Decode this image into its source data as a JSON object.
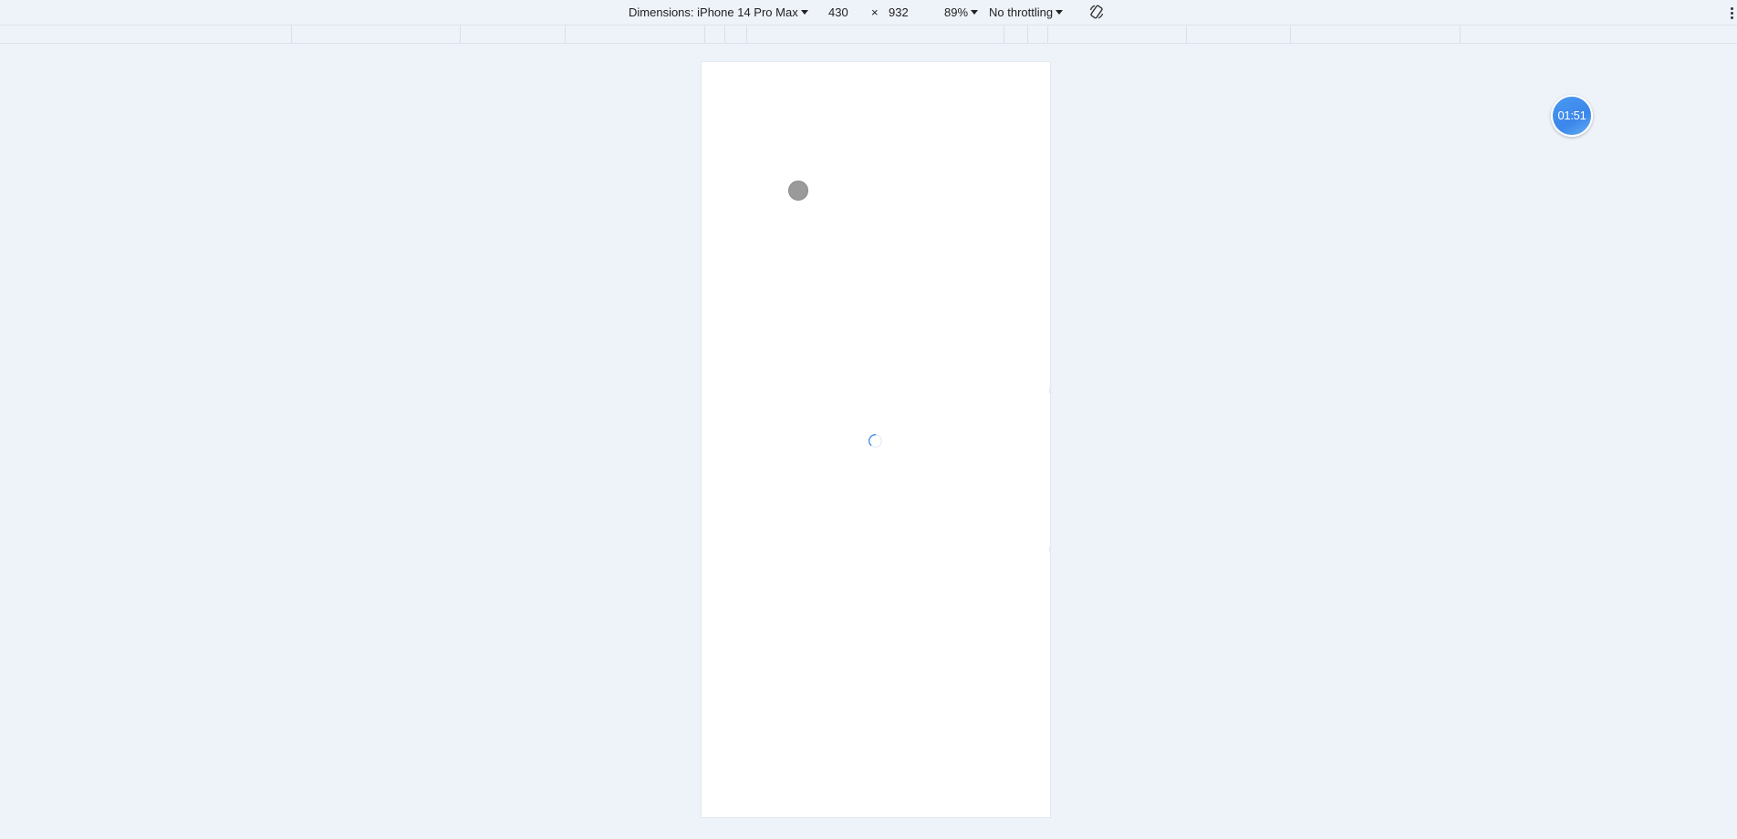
{
  "toolbar": {
    "dimensions_label": "Dimensions: iPhone 14 Pro Max",
    "width_value": "430",
    "times_symbol": "×",
    "height_value": "932",
    "zoom_label": "89%",
    "throttling_label": "No throttling"
  },
  "device": {
    "loading": true
  },
  "timer": {
    "time": "01:51"
  },
  "colors": {
    "background": "#eef2f9",
    "device_bg": "#ffffff",
    "timer_bg": "#3b86ea",
    "spinner": "#3b86ea"
  },
  "icons": {
    "rotate": "rotate-device-icon",
    "more": "more-options-icon",
    "spinner": "loading-spinner-icon"
  }
}
